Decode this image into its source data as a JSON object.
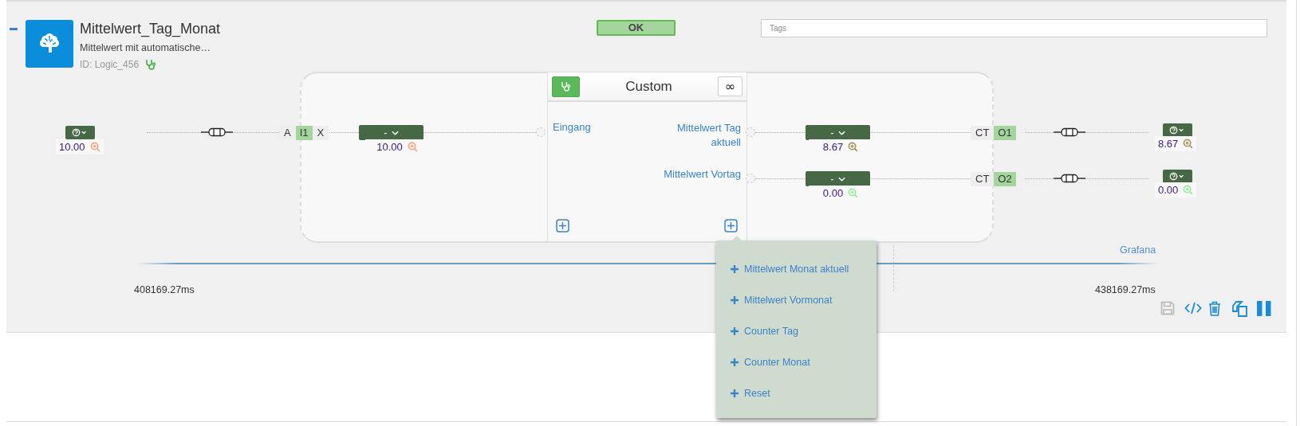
{
  "block": {
    "title": "Mittelwert_Tag_Monat",
    "subtitle": "Mittelwert mit automatische…",
    "id_label": "ID: Logic_456",
    "status": "OK",
    "tags": {
      "placeholder": "Tags"
    }
  },
  "custom": {
    "title": "Custom",
    "loop_button": "∞"
  },
  "inputs": [
    {
      "source": {
        "value": "10.00",
        "color": "#f4a688"
      },
      "pin": {
        "left": "A",
        "name": "I1",
        "right": "X"
      },
      "dropdown": "-",
      "value": "10.00",
      "color": "#f4a688",
      "port": "Eingang"
    }
  ],
  "outputs": [
    {
      "port": "Mittelwert Tag aktuell",
      "dropdown": "-",
      "value": "8.67",
      "color": "#a89560",
      "pin": {
        "left": "CT",
        "name": "O1"
      },
      "target": {
        "value": "8.67",
        "color": "#a89560"
      }
    },
    {
      "port": "Mittelwert Vortag",
      "dropdown": "-",
      "value": "0.00",
      "color": "#98ee98",
      "pin": {
        "left": "CT",
        "name": "O2"
      },
      "target": {
        "value": "0.00",
        "color": "#98ee98"
      }
    }
  ],
  "timeline": {
    "link": "Grafana",
    "start": "408169.27ms",
    "end": "438169.27ms"
  },
  "toolbar": [
    {
      "kind": "save",
      "disabled": true
    },
    {
      "kind": "code",
      "disabled": false
    },
    {
      "kind": "trash",
      "disabled": false
    },
    {
      "kind": "copy",
      "disabled": false
    },
    {
      "kind": "pause",
      "disabled": false
    }
  ],
  "menu": {
    "items": [
      "Mittelwert Monat aktuell",
      "Mittelwert Vormonat",
      "Counter Tag",
      "Counter Monat",
      "Reset"
    ]
  }
}
